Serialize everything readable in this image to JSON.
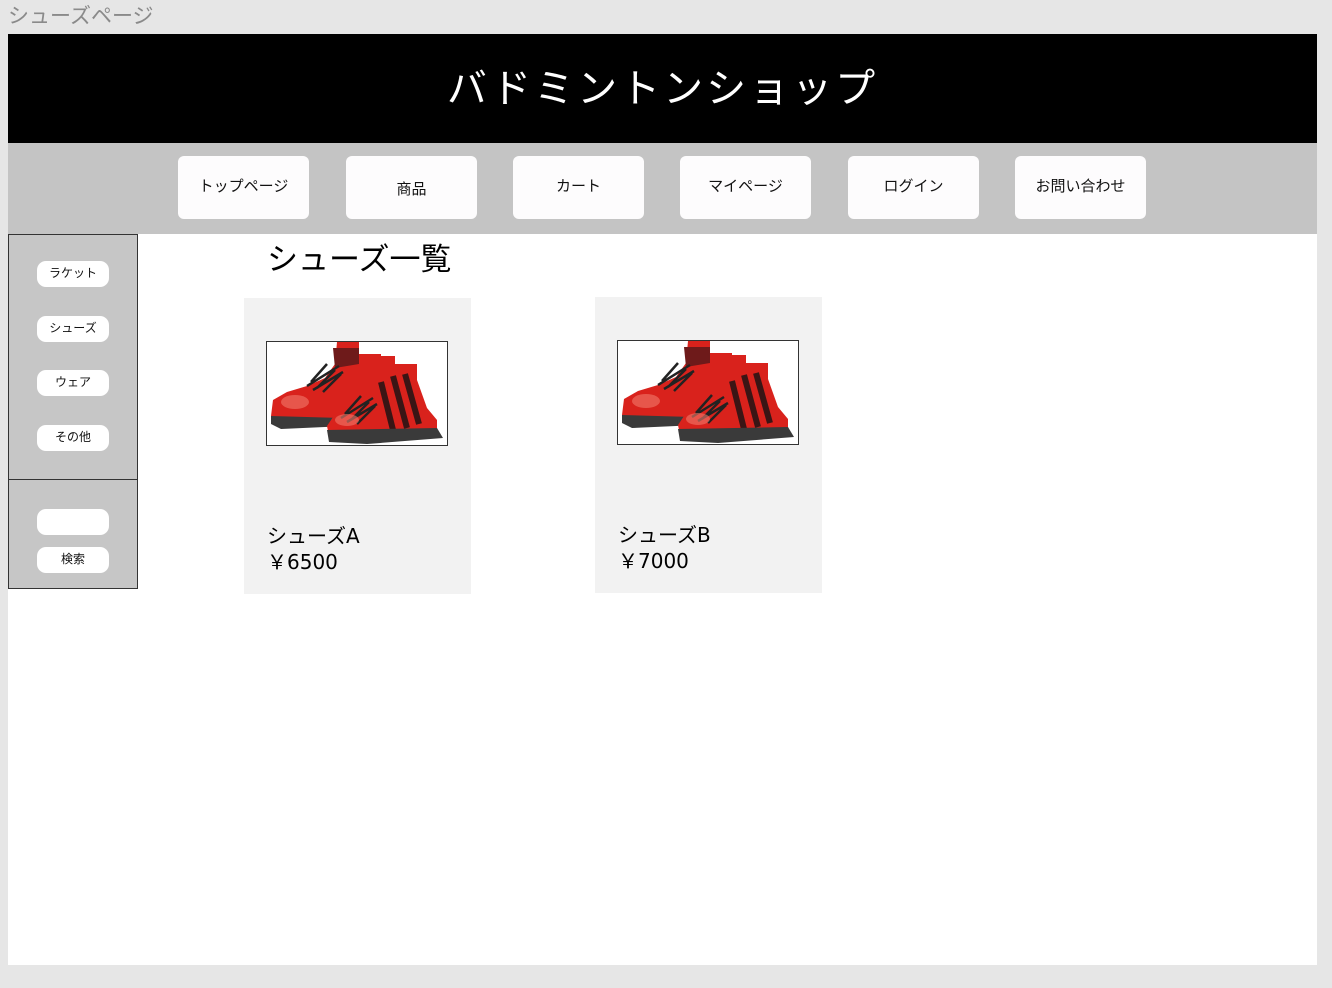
{
  "frame_label": "シューズページ",
  "header": {
    "site_title": "バドミントンショップ"
  },
  "nav": {
    "items": [
      {
        "label": "トップページ"
      },
      {
        "label": "商品"
      },
      {
        "label": "カート"
      },
      {
        "label": "マイページ"
      },
      {
        "label": "ログイン"
      },
      {
        "label": "お問い合わせ"
      }
    ]
  },
  "sidebar": {
    "categories": [
      {
        "label": "ラケット"
      },
      {
        "label": "シューズ"
      },
      {
        "label": "ウェア"
      },
      {
        "label": "その他"
      }
    ],
    "search": {
      "value": "",
      "button_label": "検索"
    }
  },
  "main": {
    "heading": "シューズ一覧",
    "products": [
      {
        "name": "シューズA",
        "price": "￥6500",
        "image": "red-sneakers-image"
      },
      {
        "name": "シューズB",
        "price": "￥7000",
        "image": "red-sneakers-image"
      }
    ]
  },
  "colors": {
    "header_bg": "#000000",
    "nav_bg": "#c4c4c4",
    "sidebar_bg": "#c6c6c6",
    "card_bg": "#f2f2f2",
    "shoe_red": "#d9221c",
    "shoe_dark": "#3a1515"
  }
}
